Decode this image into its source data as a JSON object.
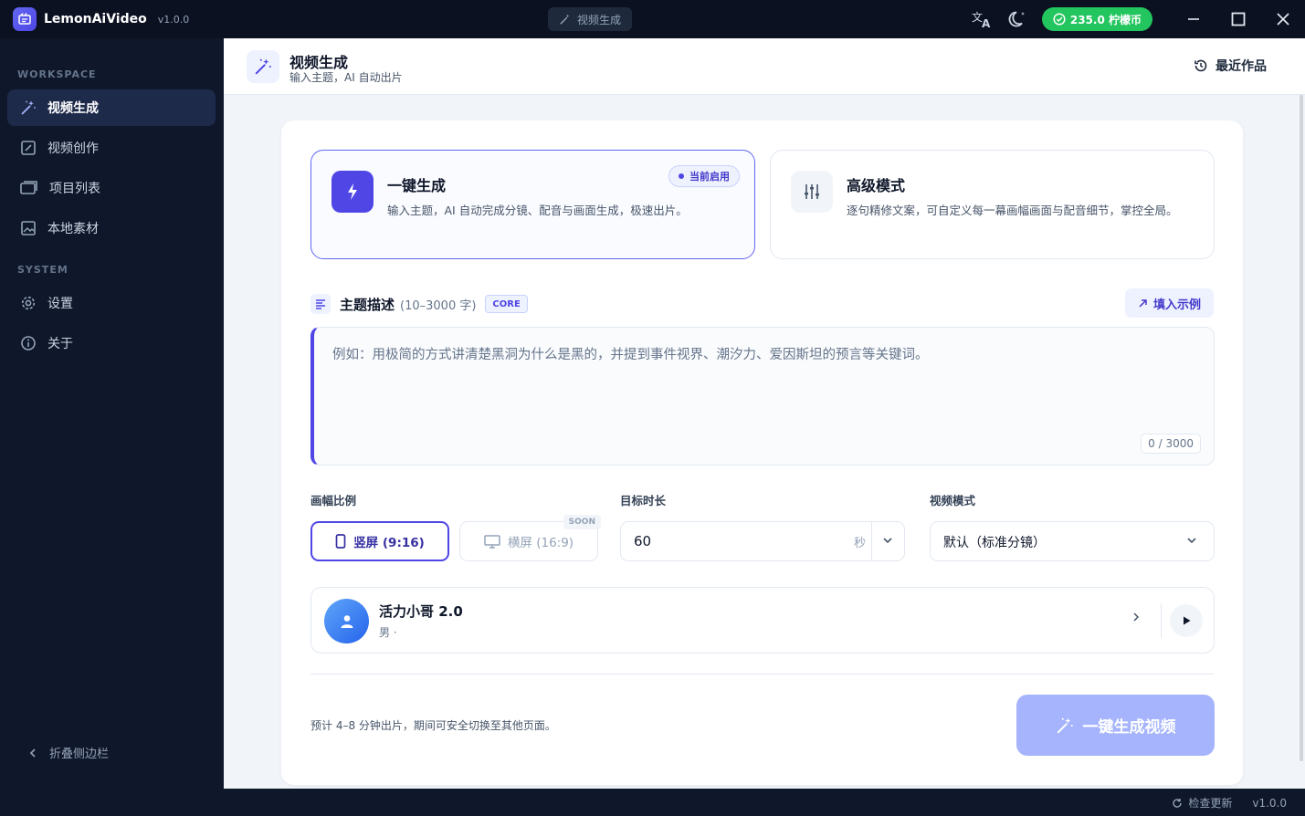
{
  "app": {
    "name": "LemonAiVideo",
    "version": "v1.0.0"
  },
  "titlebar": {
    "center_label": "视频生成",
    "coins": "235.0 柠檬币"
  },
  "sidebar": {
    "workspace_title": "WORKSPACE",
    "system_title": "SYSTEM",
    "items": [
      {
        "label": "视频生成",
        "icon": "magic-wand-icon",
        "active": true
      },
      {
        "label": "视频创作",
        "icon": "edit-square-icon",
        "active": false
      },
      {
        "label": "项目列表",
        "icon": "folder-icon",
        "active": false
      },
      {
        "label": "本地素材",
        "icon": "image-icon",
        "active": false
      }
    ],
    "system_items": [
      {
        "label": "设置",
        "icon": "gear-icon"
      },
      {
        "label": "关于",
        "icon": "info-icon"
      }
    ],
    "collapse_label": "折叠侧边栏"
  },
  "header": {
    "title": "视频生成",
    "subtitle": "输入主题，AI 自动出片",
    "recent_label": "最近作品"
  },
  "modes": [
    {
      "title": "一键生成",
      "desc": "输入主题，AI 自动完成分镜、配音与画面生成，极速出片。",
      "badge": "当前启用"
    },
    {
      "title": "高级模式",
      "desc": "逐句精修文案，可自定义每一幕画幅画面与配音细节，掌控全局。"
    }
  ],
  "topic": {
    "label": "主题描述",
    "hint": "(10–3000 字)",
    "tag": "CORE",
    "fill_example": "填入示例",
    "placeholder": "例如：用极简的方式讲清楚黑洞为什么是黑的，并提到事件视界、潮汐力、爱因斯坦的预言等关键词。",
    "counter": "0 / 3000"
  },
  "ratio": {
    "label": "画幅比例",
    "portrait": "竖屏 (9:16)",
    "landscape": "横屏 (16:9)",
    "soon": "SOON"
  },
  "duration": {
    "label": "目标时长",
    "value": "60",
    "unit": "秒"
  },
  "video_mode": {
    "label": "视频模式",
    "value": "默认（标准分镜）"
  },
  "voice": {
    "name": "活力小哥 2.0",
    "sub": "男 ·"
  },
  "footer": {
    "note": "预计 4–8 分钟出片，期间可安全切换至其他页面。",
    "generate": "一键生成视频"
  },
  "statusbar": {
    "check_update": "检查更新",
    "version": "v1.0.0"
  },
  "colors": {
    "accent": "#4f46e5",
    "coins": "#22c55e",
    "sidebar": "#0f172a"
  }
}
